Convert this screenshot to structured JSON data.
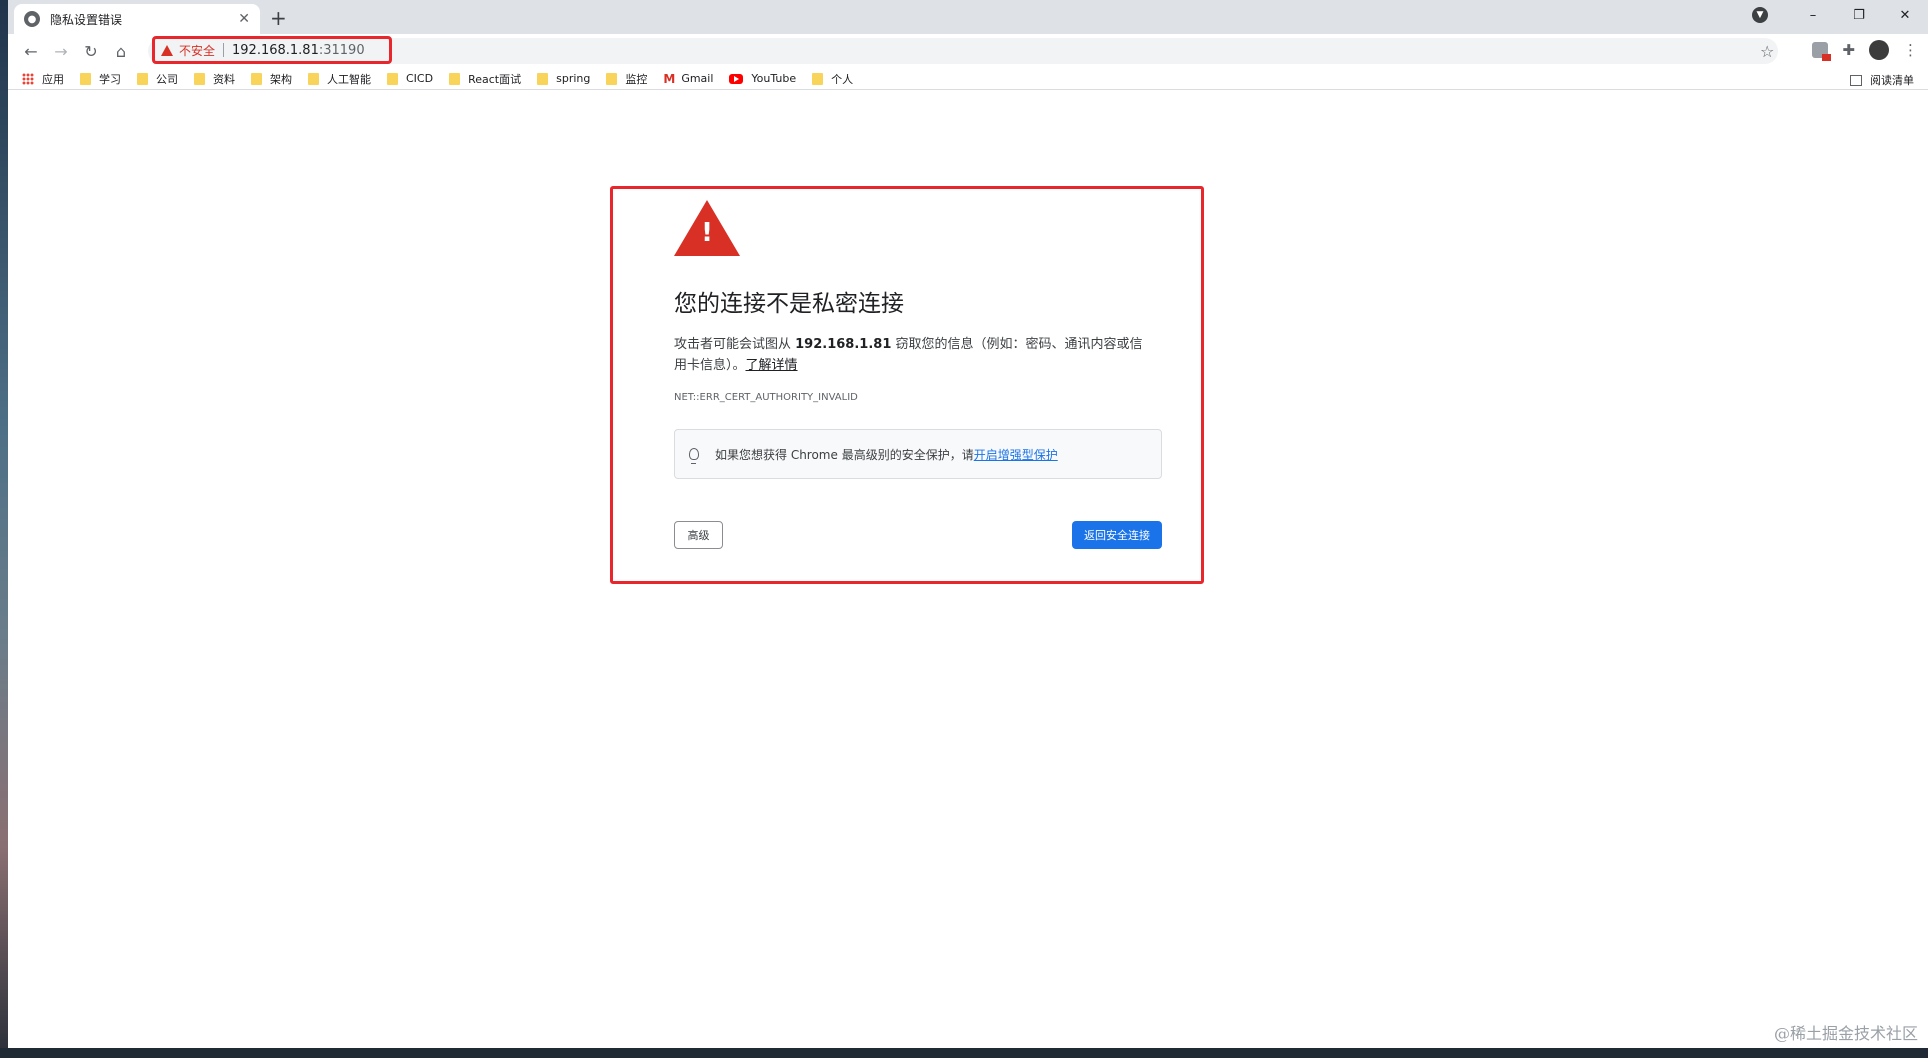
{
  "tab": {
    "title": "隐私设置错误",
    "close": "✕"
  },
  "new_tab": "+",
  "window_controls": {
    "minimize": "–",
    "restore": "❐",
    "close": "✕"
  },
  "nav": {
    "back": "←",
    "forward": "→",
    "reload": "↻",
    "home": "⌂"
  },
  "address": {
    "security_label": "不安全",
    "host": "192.168.1.81",
    "port": ":31190"
  },
  "bookmark_star": "☆",
  "bookmarks": {
    "apps": "应用",
    "items": [
      "学习",
      "公司",
      "资料",
      "架构",
      "人工智能",
      "CICD",
      "React面试",
      "spring",
      "监控"
    ],
    "gmail": "Gmail",
    "youtube": "YouTube",
    "personal": "个人",
    "reading_list": "阅读清单"
  },
  "interstitial": {
    "heading": "您的连接不是私密连接",
    "desc_prefix": "攻击者可能会试图从 ",
    "desc_host": "192.168.1.81",
    "desc_suffix": " 窃取您的信息（例如：密码、通讯内容或信用卡信息）。",
    "learn_more": "了解详情",
    "error_code": "NET::ERR_CERT_AUTHORITY_INVALID",
    "tip_text": "如果您想获得 Chrome 最高级别的安全保护，请",
    "tip_link": "开启增强型保护",
    "advanced_button": "高级",
    "back_button": "返回安全连接"
  },
  "watermark": "@稀土掘金技术社区",
  "colors": {
    "danger": "#d93025",
    "primary": "#1a73e8",
    "highlight": "#e8262c"
  }
}
